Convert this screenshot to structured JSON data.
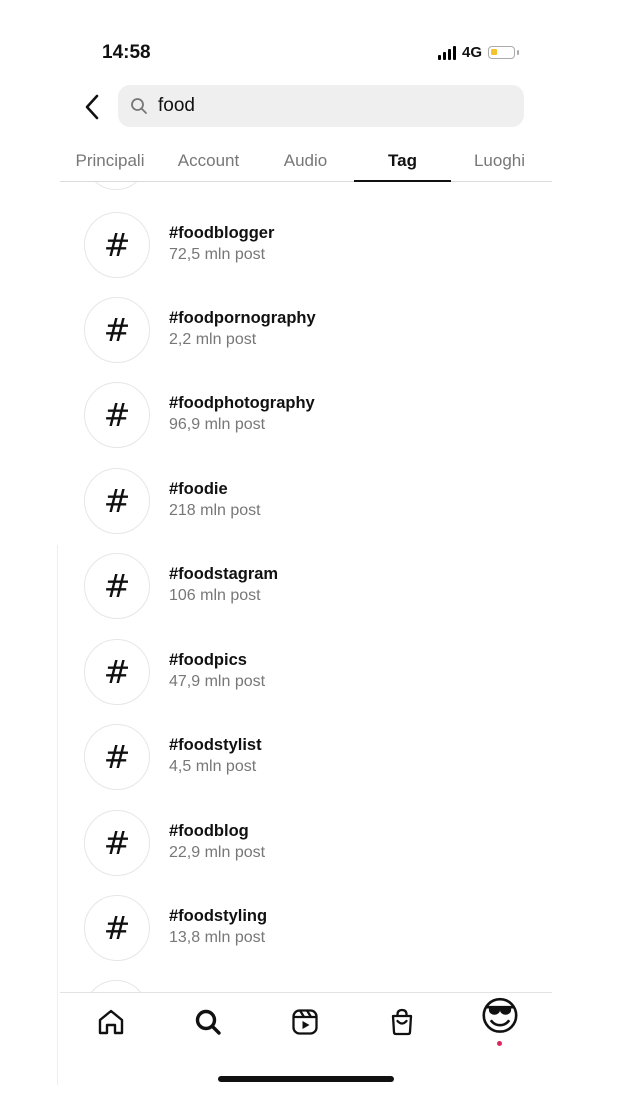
{
  "status": {
    "time": "14:58",
    "network": "4G",
    "battery_level": 0.3
  },
  "header": {
    "back_icon": "chevron-left-icon",
    "search": {
      "value": "food",
      "icon": "search-icon"
    }
  },
  "tabs": [
    {
      "label": "Principali",
      "active": false
    },
    {
      "label": "Account",
      "active": false
    },
    {
      "label": "Audio",
      "active": false
    },
    {
      "label": "Tag",
      "active": true
    },
    {
      "label": "Luoghi",
      "active": false
    }
  ],
  "hashtags": [
    {
      "symbol": "#",
      "name": "#foodblogger",
      "count": "72,5 mln post"
    },
    {
      "symbol": "#",
      "name": "#foodpornography",
      "count": "2,2 mln post"
    },
    {
      "symbol": "#",
      "name": "#foodphotography",
      "count": "96,9 mln post"
    },
    {
      "symbol": "#",
      "name": "#foodie",
      "count": "218 mln post"
    },
    {
      "symbol": "#",
      "name": "#foodstagram",
      "count": "106 mln post"
    },
    {
      "symbol": "#",
      "name": "#foodpics",
      "count": "47,9 mln post"
    },
    {
      "symbol": "#",
      "name": "#foodstylist",
      "count": "4,5 mln post"
    },
    {
      "symbol": "#",
      "name": "#foodblog",
      "count": "22,9 mln post"
    },
    {
      "symbol": "#",
      "name": "#foodstyling",
      "count": "13,8 mln post"
    }
  ],
  "bottom_nav": {
    "items": [
      "home-icon",
      "search-icon",
      "reels-icon",
      "shop-icon",
      "profile-avatar"
    ],
    "profile_emoji": "😎",
    "notification_color": "#e0245e"
  },
  "colors": {
    "accent": "#111111",
    "secondary_text": "#777777",
    "notification": "#e0245e",
    "battery": "#f4c430"
  }
}
